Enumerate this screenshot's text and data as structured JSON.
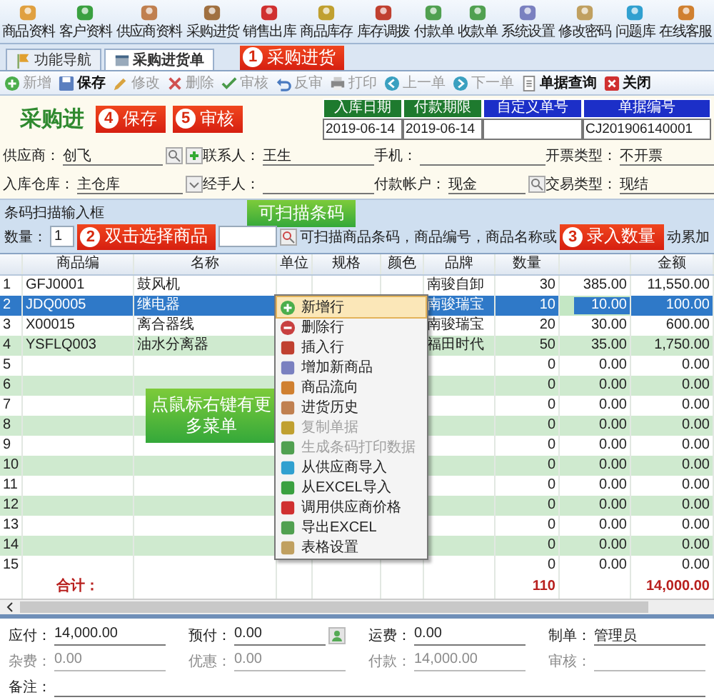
{
  "menu_bar": [
    {
      "label": "商品资料"
    },
    {
      "label": "客户资料"
    },
    {
      "label": "供应商资料"
    },
    {
      "label": "采购进货"
    },
    {
      "label": "销售出库"
    },
    {
      "label": "商品库存"
    },
    {
      "label": "库存调拨"
    },
    {
      "label": "付款单"
    },
    {
      "label": "收款单"
    },
    {
      "label": "系统设置"
    },
    {
      "label": "修改密码"
    },
    {
      "label": "问题库"
    },
    {
      "label": "在线客服"
    }
  ],
  "tabs": [
    {
      "label": "功能导航",
      "selected": false
    },
    {
      "label": "采购进货单",
      "selected": true
    }
  ],
  "tabs_callout": {
    "kind": "numbered",
    "number": "1",
    "text": "采购进货"
  },
  "toolbar": [
    {
      "label": "新增",
      "disabled": true
    },
    {
      "label": "保存",
      "disabled": false
    },
    {
      "label": "修改",
      "disabled": true
    },
    {
      "label": "删除",
      "disabled": true
    },
    {
      "label": "审核",
      "disabled": true
    },
    {
      "label": "反审",
      "disabled": true
    },
    {
      "label": "打印",
      "disabled": true
    },
    {
      "label": "上一单",
      "disabled": true
    },
    {
      "label": "下一单",
      "disabled": true
    },
    {
      "label": "单据查询",
      "disabled": false
    },
    {
      "label": "关闭",
      "disabled": false
    }
  ],
  "header": {
    "title": "采购进",
    "callouts": [
      {
        "kind": "numbered",
        "number": "4",
        "text": "保存"
      },
      {
        "kind": "numbered",
        "number": "5",
        "text": "审核"
      }
    ],
    "doc_fields": [
      {
        "label": "入库日期",
        "value": "2019-06-14",
        "color": "#1e7a2e"
      },
      {
        "label": "付款期限",
        "value": "2019-06-14",
        "color": "#1e7a2e"
      },
      {
        "label": "自定义单号",
        "color": "#1c2fc8"
      },
      {
        "label": "单据编号",
        "value": "CJ201906140001",
        "color": "#1c2fc8"
      }
    ],
    "field_rows": [
      [
        {
          "label": "供应商：",
          "value": "创飞",
          "kind": "lookup_add"
        },
        {
          "label": "联系人：",
          "value": "王生",
          "kind": "text"
        },
        {
          "label": "手机：",
          "kind": "text"
        },
        {
          "label": "开票类型：",
          "value": "不开票",
          "kind": "text"
        }
      ],
      [
        {
          "label": "入库仓库：",
          "value": "主仓库",
          "kind": "dropdown"
        },
        {
          "label": "经手人：",
          "kind": "text"
        },
        {
          "label": "付款帐户：",
          "value": "现金",
          "kind": "lookup"
        },
        {
          "label": "交易类型：",
          "value": "现结",
          "kind": "text"
        }
      ]
    ]
  },
  "barcode": {
    "title": "条码扫描输入框",
    "title_callout": {
      "kind": "bubble",
      "text": "可扫描条码"
    },
    "qty_label": "数量：",
    "qty_value": "1",
    "input_callout": {
      "kind": "numbered",
      "number": "2",
      "text": "双击选择商品"
    },
    "hint": "可扫描商品条码，商品编号，商品名称或",
    "hint_callout": {
      "kind": "numbered",
      "number": "3",
      "text": "录入数量"
    },
    "hint_end": "动累加"
  },
  "table": {
    "columns": [
      {
        "kind": "text",
        "label": "商品编"
      },
      {
        "kind": "text",
        "label": "名称"
      },
      {
        "kind": "text",
        "label": "单位"
      },
      {
        "kind": "text",
        "label": "规格"
      },
      {
        "kind": "text",
        "label": "颜色"
      },
      {
        "kind": "text",
        "label": "品牌"
      },
      {
        "kind": "text",
        "label": "数量"
      },
      {
        "kind": "blank"
      },
      {
        "kind": "text",
        "label": "金额"
      }
    ],
    "rows": [
      {
        "no": "1",
        "code": "GFJ0001",
        "name": "鼓风机",
        "brand": "南骏自卸",
        "qty": "30",
        "price": "385.00",
        "amount": "11,550.00",
        "selected": false,
        "editing": false
      },
      {
        "no": "2",
        "code": "JDQ0005",
        "name": "继电器",
        "brand": "南骏瑞宝",
        "qty": "10",
        "price": "10.00",
        "amount": "100.00",
        "selected": true,
        "editing": true
      },
      {
        "no": "3",
        "code": "X00015",
        "name": "离合器线",
        "brand": "南骏瑞宝",
        "qty": "20",
        "price": "30.00",
        "amount": "600.00",
        "selected": false,
        "editing": false
      },
      {
        "no": "4",
        "code": "YSFLQ003",
        "name": "油水分离器",
        "brand": "福田时代",
        "qty": "50",
        "price": "35.00",
        "amount": "1,750.00",
        "selected": false,
        "editing": false
      },
      {
        "no": "5",
        "qty": "0",
        "price": "0.00",
        "amount": "0.00",
        "selected": false,
        "editing": false
      },
      {
        "no": "6",
        "qty": "0",
        "price": "0.00",
        "amount": "0.00",
        "selected": false,
        "editing": false
      },
      {
        "no": "7",
        "qty": "0",
        "price": "0.00",
        "amount": "0.00",
        "selected": false,
        "editing": false
      },
      {
        "no": "8",
        "qty": "0",
        "price": "0.00",
        "amount": "0.00",
        "selected": false,
        "editing": false
      },
      {
        "no": "9",
        "qty": "0",
        "price": "0.00",
        "amount": "0.00",
        "selected": false,
        "editing": false
      },
      {
        "no": "10",
        "qty": "0",
        "price": "0.00",
        "amount": "0.00",
        "selected": false,
        "editing": false
      },
      {
        "no": "11",
        "qty": "0",
        "price": "0.00",
        "amount": "0.00",
        "selected": false,
        "editing": false
      },
      {
        "no": "12",
        "qty": "0",
        "price": "0.00",
        "amount": "0.00",
        "selected": false,
        "editing": false
      },
      {
        "no": "13",
        "qty": "0",
        "price": "0.00",
        "amount": "0.00",
        "selected": false,
        "editing": false
      },
      {
        "no": "14",
        "qty": "0",
        "price": "0.00",
        "amount": "0.00",
        "selected": false,
        "editing": false
      },
      {
        "no": "15",
        "qty": "0",
        "price": "0.00",
        "amount": "0.00",
        "selected": false,
        "editing": false
      }
    ],
    "totals": {
      "label": "合计：",
      "qty": "110",
      "amount": "14,000.00"
    },
    "callout": {
      "kind": "bubble",
      "text": "点鼠标右键有更多菜单"
    },
    "context_menu": [
      {
        "label": "新增行",
        "selected": true,
        "disabled": false
      },
      {
        "label": "删除行",
        "selected": false,
        "disabled": false
      },
      {
        "label": "插入行",
        "selected": false,
        "disabled": false
      },
      {
        "label": "增加新商品",
        "selected": false,
        "disabled": false
      },
      {
        "label": "商品流向",
        "selected": false,
        "disabled": false
      },
      {
        "label": "进货历史",
        "selected": false,
        "disabled": false
      },
      {
        "label": "复制单据",
        "selected": false,
        "disabled": true
      },
      {
        "label": "生成条码打印数据",
        "selected": false,
        "disabled": true
      },
      {
        "label": "从供应商导入",
        "selected": false,
        "disabled": false
      },
      {
        "label": "从EXCEL导入",
        "selected": false,
        "disabled": false
      },
      {
        "label": "调用供应商价格",
        "selected": false,
        "disabled": false
      },
      {
        "label": "导出EXCEL",
        "selected": false,
        "disabled": false
      },
      {
        "label": "表格设置",
        "selected": false,
        "disabled": false
      }
    ]
  },
  "footer": {
    "fields": [
      {
        "label": "应付：",
        "value": "14,000.00",
        "disabled": false,
        "kind": "text"
      },
      {
        "label": "预付：",
        "value": "0.00",
        "disabled": false,
        "kind": "lookup"
      },
      {
        "label": "运费：",
        "value": "0.00",
        "disabled": false,
        "kind": "text"
      },
      {
        "label": "制单：",
        "value": "管理员",
        "disabled": false,
        "kind": "text"
      },
      {
        "label": "杂费：",
        "value": "0.00",
        "disabled": true,
        "kind": "text"
      },
      {
        "label": "优惠：",
        "value": "0.00",
        "disabled": true,
        "kind": "text"
      },
      {
        "label": "付款：",
        "value": "14,000.00",
        "disabled": true,
        "kind": "text"
      },
      {
        "label": "审核：",
        "disabled": true,
        "kind": "text"
      }
    ],
    "note_label": "备注："
  }
}
